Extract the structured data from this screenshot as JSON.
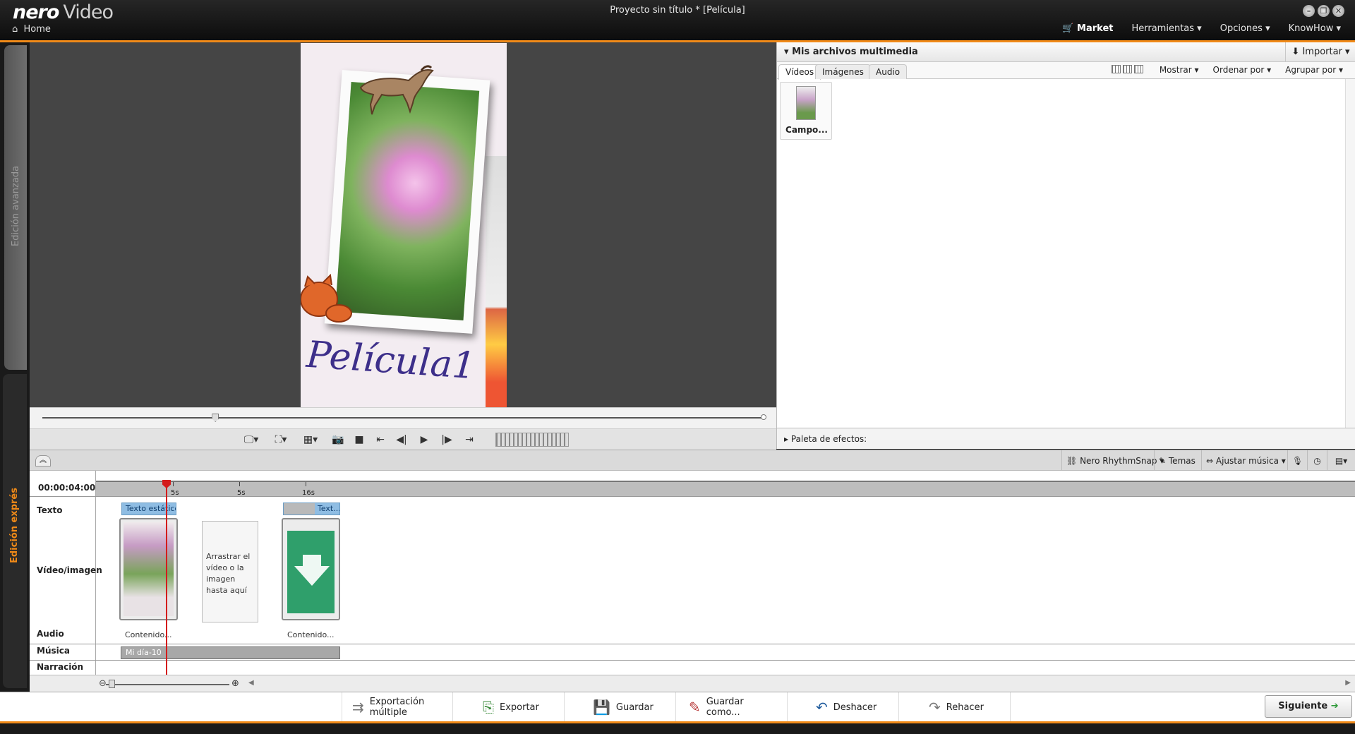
{
  "app": {
    "brand": "nero",
    "product": "Video",
    "window_title": "Proyecto sin título * [Película]"
  },
  "titlebar": {
    "home": "Home",
    "market": "Market",
    "menus": [
      "Herramientas",
      "Opciones",
      "KnowHow"
    ]
  },
  "left_tabs": {
    "advanced": "Edición avanzada",
    "express": "Edición exprés"
  },
  "preview": {
    "overlay_title": "Película1"
  },
  "media_panel": {
    "title": "Mis archivos multimedia",
    "import": "Importar",
    "tabs": [
      "Vídeos",
      "Imágenes",
      "Audio"
    ],
    "active_tab": "Vídeos",
    "tools": [
      "Mostrar",
      "Ordenar por",
      "Agrupar por"
    ],
    "items": [
      {
        "label": "Campo..."
      }
    ]
  },
  "effects": {
    "label": "Paleta de efectos:"
  },
  "timeline_toolbar": {
    "rhythmsnap": "Nero RhythmSnap",
    "themes": "Temas",
    "fit_music": "Ajustar música"
  },
  "timeline": {
    "timecode": "00:00:04:00",
    "ruler_ticks": [
      "5s",
      "5s",
      "16s"
    ],
    "track_labels": [
      "Texto",
      "Vídeo/imagen",
      "Audio",
      "Música",
      "Narración"
    ],
    "text_clips": [
      "Texto estático",
      "Text..."
    ],
    "video_clip_labels": [
      "Contenido...",
      "Contenido..."
    ],
    "drop_hint": "Arrastrar el vídeo o la imagen hasta aquí",
    "music_clip": "Mi día-10"
  },
  "bottom": {
    "multi_export": "Exportación múltiple",
    "export": "Exportar",
    "save": "Guardar",
    "save_as": "Guardar como...",
    "undo": "Deshacer",
    "redo": "Rehacer",
    "next": "Siguiente"
  },
  "colors": {
    "accent": "#f08a18",
    "playhead": "#d41c1c",
    "text_clip": "#8fbde3",
    "titlebar": "#111111"
  },
  "playback": {
    "position_fraction": 0.24
  }
}
